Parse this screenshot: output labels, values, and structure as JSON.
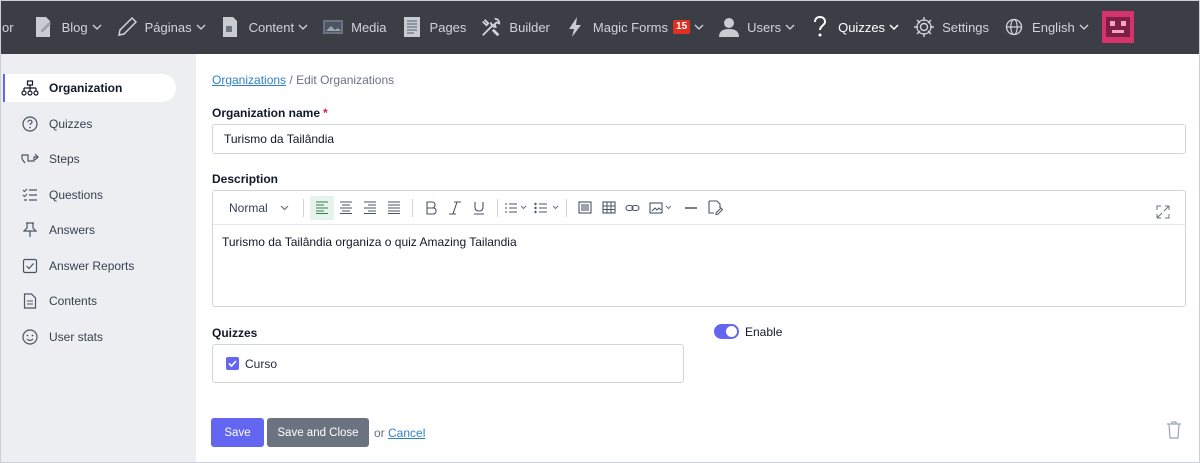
{
  "topnav": {
    "partial_label": "or",
    "items": [
      {
        "label": "Blog",
        "icon": "blog-icon",
        "caret": true
      },
      {
        "label": "Páginas",
        "icon": "pencil-icon",
        "caret": true
      },
      {
        "label": "Content",
        "icon": "content-icon",
        "caret": true
      },
      {
        "label": "Media",
        "icon": "media-icon",
        "caret": false
      },
      {
        "label": "Pages",
        "icon": "pages-icon",
        "caret": false
      },
      {
        "label": "Builder",
        "icon": "tools-icon",
        "caret": false
      },
      {
        "label": "Magic Forms",
        "icon": "bolt-icon",
        "caret": true,
        "badge": "15"
      },
      {
        "label": "Users",
        "icon": "user-icon",
        "caret": true
      },
      {
        "label": "Quizzes",
        "icon": "question-icon",
        "caret": true,
        "active": true
      },
      {
        "label": "Settings",
        "icon": "gear-icon",
        "caret": false
      },
      {
        "label": "English",
        "icon": "globe-icon",
        "caret": true
      }
    ]
  },
  "sidebar": {
    "items": [
      {
        "label": "Organization",
        "icon": "org-icon",
        "active": true
      },
      {
        "label": "Quizzes",
        "icon": "question-circle-icon"
      },
      {
        "label": "Steps",
        "icon": "steps-icon"
      },
      {
        "label": "Questions",
        "icon": "list-icon"
      },
      {
        "label": "Answers",
        "icon": "pin-icon"
      },
      {
        "label": "Answer Reports",
        "icon": "check-square-icon"
      },
      {
        "label": "Contents",
        "icon": "document-icon"
      },
      {
        "label": "User stats",
        "icon": "smile-icon"
      }
    ]
  },
  "breadcrumb": {
    "link": "Organizations",
    "separator": " / ",
    "current": "Edit Organizations"
  },
  "form": {
    "name_label": "Organization name",
    "required_mark": "*",
    "name_value": "Turismo da Tailândia",
    "description_label": "Description",
    "editor_style": "Normal",
    "description_value": "Turismo da Tailândia organiza o quiz Amazing Tailandia",
    "quizzes_label": "Quizzes",
    "quiz_items": [
      {
        "label": "Curso",
        "checked": true
      }
    ],
    "enable_label": "Enable",
    "enable_on": true
  },
  "actions": {
    "save": "Save",
    "save_close": "Save and Close",
    "or": "or",
    "cancel": "Cancel"
  },
  "colors": {
    "accent": "#6366f1",
    "topbar": "#3b3f45",
    "badge": "#e0301e",
    "link": "#2f80c9"
  }
}
